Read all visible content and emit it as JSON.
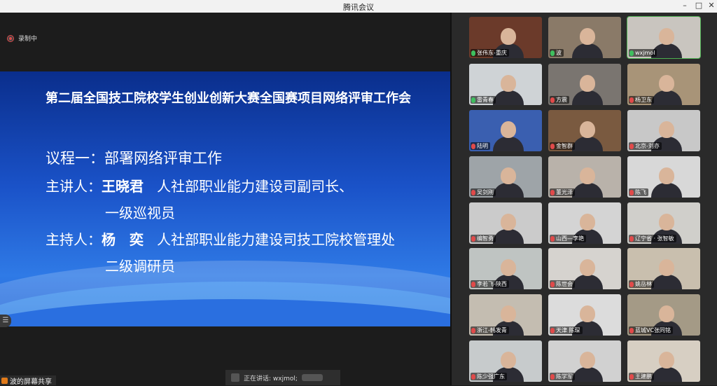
{
  "window": {
    "title": "腾讯会议",
    "controls": [
      "–",
      "□",
      "✕"
    ]
  },
  "recording": {
    "label": "录制中"
  },
  "slide": {
    "title": "第二届全国技工院校学生创业创新大赛全国赛项目网络评审工作会",
    "agenda": "议程一：部署网络评审工作",
    "speaker_label": "主讲人：",
    "speaker_name": "王晓君",
    "speaker_role": "人社部职业能力建设司副司长、",
    "speaker_role2": "一级巡视员",
    "host_label": "主持人：",
    "host_name": "杨　奕",
    "host_role": "人社部职业能力建设司技工院校管理处",
    "host_role2": "二级调研员"
  },
  "screen_share": {
    "label": "波的屏幕共享"
  },
  "speaking": {
    "label": "正在讲话: wxjmol;"
  },
  "participants": [
    {
      "name": "张伟东-重庆",
      "bg": "#6b3a2a",
      "mic": "on"
    },
    {
      "name": "波",
      "bg": "#8a7a68",
      "mic": "on"
    },
    {
      "name": "wxjmol",
      "bg": "#c9c5bf",
      "mic": "on",
      "active": true
    },
    {
      "name": "雷青春",
      "bg": "#cfd3d6",
      "mic": "on"
    },
    {
      "name": "方震",
      "bg": "#7a7570",
      "mic": "off"
    },
    {
      "name": "杨卫东",
      "bg": "#a89478",
      "mic": "off"
    },
    {
      "name": "陆明",
      "bg": "#3a5fb0",
      "mic": "off"
    },
    {
      "name": "金智群",
      "bg": "#7a5a40",
      "mic": "off"
    },
    {
      "name": "北京-刘亦",
      "bg": "#c8c8c8",
      "mic": "off"
    },
    {
      "name": "吴剑刚",
      "bg": "#9ea4a8",
      "mic": "off"
    },
    {
      "name": "董光泽",
      "bg": "#b9b2aa",
      "mic": "off"
    },
    {
      "name": "陈飞",
      "bg": "#d8d8d8",
      "mic": "off"
    },
    {
      "name": "编智勇",
      "bg": "#cbcbcb",
      "mic": "off"
    },
    {
      "name": "山西—李艳",
      "bg": "#d4d4d4",
      "mic": "off"
    },
    {
      "name": "辽宁省 · 张智敏",
      "bg": "#d0cfcb",
      "mic": "off"
    },
    {
      "name": "李若飞-陕西",
      "bg": "#bfc4c2",
      "mic": "off"
    },
    {
      "name": "陈世会",
      "bg": "#d6d3cf",
      "mic": "off"
    },
    {
      "name": "姚岳林",
      "bg": "#c9bfae",
      "mic": "off"
    },
    {
      "name": "浙江-韩发青",
      "bg": "#c4bdb1",
      "mic": "off"
    },
    {
      "name": "天津 陈琛",
      "bg": "#dcdcdc",
      "mic": "off"
    },
    {
      "name": "蓝城VC张同铭",
      "bg": "#a49a86",
      "mic": "off"
    },
    {
      "name": "陈少强广东",
      "bg": "#c7cbcc",
      "mic": "off"
    },
    {
      "name": "陈学军",
      "bg": "#d1d1d1",
      "mic": "off"
    },
    {
      "name": "王建鹏",
      "bg": "#d7cfc3",
      "mic": "off"
    }
  ]
}
